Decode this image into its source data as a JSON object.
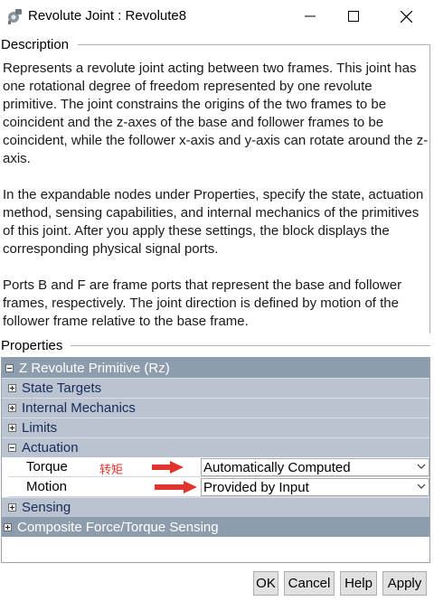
{
  "window": {
    "title": "Revolute Joint : Revolute8",
    "app_icon": "revolute-joint-icon"
  },
  "description": {
    "label": "Description",
    "paragraphs": [
      "Represents a revolute joint acting between two frames. This joint has one rotational degree of freedom represented by one revolute primitive. The joint constrains the origins of the two frames to be coincident and the z-axes of the base and follower frames to be coincident, while the follower x-axis and y-axis can rotate around the z-axis.",
      "In the expandable nodes under Properties, specify the state, actuation method, sensing capabilities, and internal mechanics of the primitives of this joint. After you apply these settings, the block displays the corresponding physical signal ports.",
      "Ports B and F are frame ports that represent the base and follower frames, respectively. The joint direction is defined by motion of the follower frame relative to the base frame."
    ]
  },
  "properties": {
    "label": "Properties",
    "primitive": "Z Revolute Primitive (Rz)",
    "nodes": [
      {
        "label": "State Targets",
        "expanded": false
      },
      {
        "label": "Internal Mechanics",
        "expanded": false
      },
      {
        "label": "Limits",
        "expanded": false
      },
      {
        "label": "Actuation",
        "expanded": true
      }
    ],
    "actuation": {
      "torque": {
        "label": "Torque",
        "note": "转矩",
        "value": "Automatically Computed"
      },
      "motion": {
        "label": "Motion",
        "value": "Provided by Input"
      }
    },
    "sensing": "Sensing",
    "composite": "Composite Force/Torque Sensing"
  },
  "buttons": {
    "ok": "OK",
    "cancel": "Cancel",
    "help": "Help",
    "apply": "Apply"
  },
  "colors": {
    "header_row": "#8d9dae",
    "sub_row": "#b9c4d0",
    "annotation_red": "#e0342c"
  }
}
